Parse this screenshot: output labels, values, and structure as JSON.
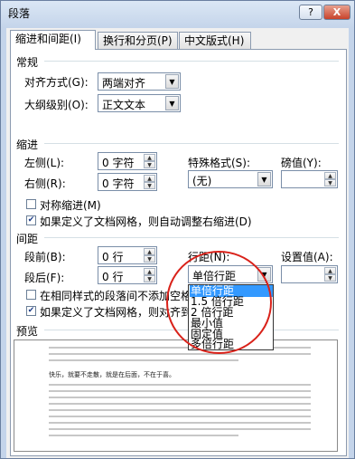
{
  "window": {
    "title": "段落",
    "help_label": "?",
    "close_label": "X"
  },
  "tabs": [
    {
      "label": "缩进和间距(I)"
    },
    {
      "label": "换行和分页(P)"
    },
    {
      "label": "中文版式(H)"
    }
  ],
  "general": {
    "header": "常规",
    "alignment_label": "对齐方式(G):",
    "alignment_value": "两端对齐",
    "outline_label": "大纲级别(O):",
    "outline_value": "正文文本"
  },
  "indent": {
    "header": "缩进",
    "left_label": "左侧(L):",
    "left_value": "0 字符",
    "right_label": "右侧(R):",
    "right_value": "0 字符",
    "special_label": "特殊格式(S):",
    "special_value": "(无)",
    "by_label": "磅值(Y):",
    "by_value": "",
    "mirror_label": "对称缩进(M)",
    "mirror_checked": false,
    "auto_adjust_label": "如果定义了文档网格，则自动调整右缩进(D)",
    "auto_adjust_checked": true
  },
  "spacing": {
    "header": "间距",
    "before_label": "段前(B):",
    "before_value": "0 行",
    "after_label": "段后(F):",
    "after_value": "0 行",
    "line_label": "行距(N):",
    "line_value": "单倍行距",
    "at_label": "设置值(A):",
    "at_value": "",
    "no_space_label": "在相同样式的段落间不添加空格",
    "no_space_checked": false,
    "snap_label": "如果定义了文档网格，则对齐到",
    "snap_checked": true
  },
  "line_spacing_options": [
    "单倍行距",
    "1.5 倍行距",
    "2 倍行距",
    "最小值",
    "固定值",
    "多倍行距"
  ],
  "preview": {
    "header": "预览",
    "sample_text": "快乐，就要不走散，就是在后面，不在于喜。"
  }
}
